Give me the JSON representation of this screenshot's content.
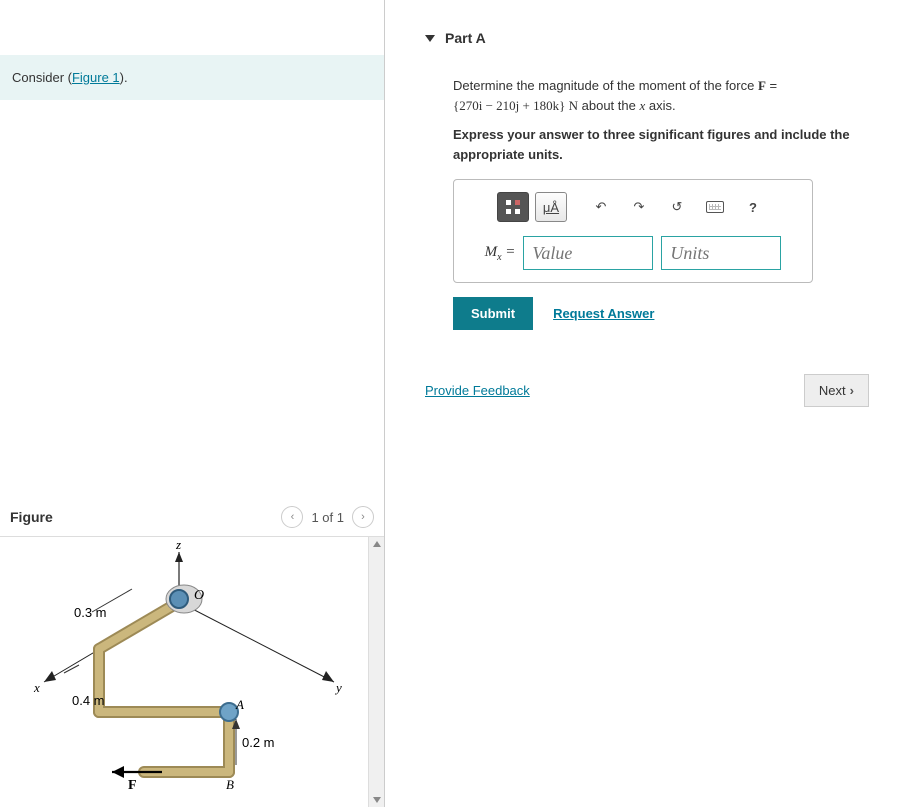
{
  "intro": {
    "prefix": "Consider (",
    "link": "Figure 1",
    "suffix": ")."
  },
  "figure": {
    "title": "Figure",
    "counter": "1 of 1",
    "labels": {
      "z": "z",
      "x": "x",
      "y": "y",
      "O": "O",
      "A": "A",
      "B": "B",
      "F": "F",
      "d1": "0.3 m",
      "d2": "0.4 m",
      "d3": "0.2 m"
    }
  },
  "part": {
    "header": "Part A",
    "problem_prefix": "Determine the magnitude of the moment of the force ",
    "force_sym": "F",
    "problem_eq_mid": " = ",
    "force_expr": "{270i − 210j + 180k} N",
    "problem_suffix_1": " about the ",
    "axis_var": "x",
    "problem_suffix_2": " axis.",
    "instruction": "Express your answer to three significant figures and include the appropriate units.",
    "toolbar": {
      "units_btn": "μÅ",
      "help_btn": "?"
    },
    "var_label_base": "M",
    "var_label_sub": "x",
    "equals": " = ",
    "value_placeholder": "Value",
    "units_placeholder": "Units",
    "submit": "Submit",
    "request": "Request Answer"
  },
  "footer": {
    "feedback": "Provide Feedback",
    "next": "Next"
  }
}
